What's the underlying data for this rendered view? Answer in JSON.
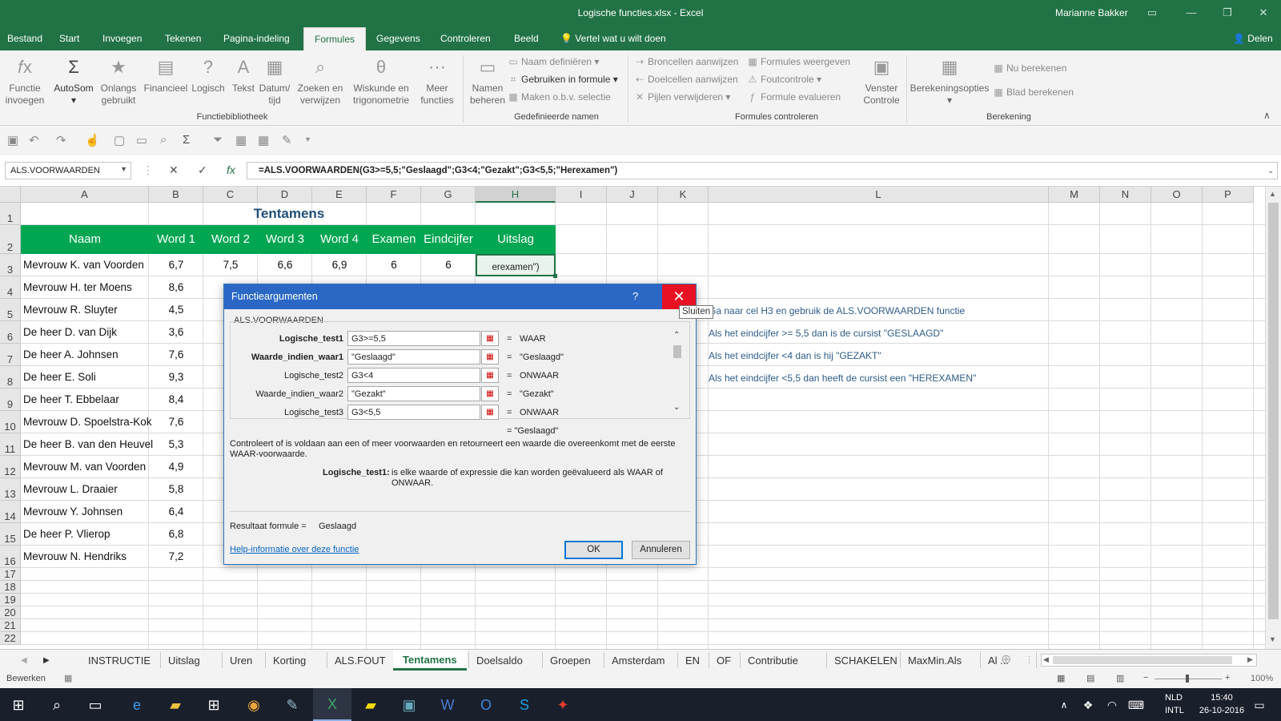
{
  "window": {
    "title": "Logische functies.xlsx - Excel",
    "user": "Marianne Bakker"
  },
  "tabs": [
    "Bestand",
    "Start",
    "Invoegen",
    "Tekenen",
    "Pagina-indeling",
    "Formules",
    "Gegevens",
    "Controleren",
    "Beeld"
  ],
  "active_tab": "Formules",
  "tell_me": "Vertel wat u wilt doen",
  "share": "Delen",
  "ribbon": {
    "functiebibliotheek": {
      "label": "Functiebibliotheek",
      "buttons": [
        "Functie invoegen",
        "AutoSom",
        "Onlangs gebruikt",
        "Financieel",
        "Logisch",
        "Tekst",
        "Datum/ tijd",
        "Zoeken en verwijzen",
        "Wiskunde en trigonometrie",
        "Meer functies"
      ]
    },
    "gedefinieerde_namen": {
      "label": "Gedefinieerde namen",
      "big": "Namen beheren",
      "items": [
        "Naam definiëren",
        "Gebruiken in formule",
        "Maken o.b.v. selectie"
      ]
    },
    "formules_controleren": {
      "label": "Formules controleren",
      "items": [
        "Broncellen aanwijzen",
        "Doelcellen aanwijzen",
        "Pijlen verwijderen",
        "Formules weergeven",
        "Foutcontrole",
        "Formule evalueren"
      ],
      "big": "Venster Controle"
    },
    "berekening": {
      "label": "Berekening",
      "big": "Berekeningsopties",
      "items": [
        "Nu berekenen",
        "Blad berekenen"
      ]
    }
  },
  "formula_bar": {
    "name_box": "ALS.VOORWAARDEN",
    "formula": "=ALS.VOORWAARDEN(G3>=5,5;\"Geslaagd\";G3<4;\"Gezakt\";G3<5,5;\"Herexamen\")"
  },
  "columns": [
    "A",
    "B",
    "C",
    "D",
    "E",
    "F",
    "G",
    "H",
    "I",
    "J",
    "K",
    "L",
    "M",
    "N",
    "O",
    "P"
  ],
  "rows": [
    "1",
    "2",
    "3",
    "4",
    "5",
    "6",
    "7",
    "8",
    "9",
    "10",
    "11",
    "12",
    "13",
    "14",
    "15",
    "16",
    "17",
    "18",
    "19",
    "20",
    "21",
    "22"
  ],
  "sheet": {
    "title": "Tentamens",
    "headers": [
      "Naam",
      "Word 1",
      "Word 2",
      "Word 3",
      "Word 4",
      "Examen",
      "Eindcijfer",
      "Uitslag"
    ],
    "row3": [
      "Mevrouw K. van Voorden",
      "6,7",
      "7,5",
      "6,6",
      "6,9",
      "6",
      "6"
    ],
    "selected_cell_text": "erexamen\")",
    "names": [
      {
        "name": "Mevrouw H. ter Moens",
        "b": "8,6"
      },
      {
        "name": "Mevrouw R. Sluyter",
        "b": "4,5"
      },
      {
        "name": "De heer D. van Dijk",
        "b": "3,6"
      },
      {
        "name": "De heer A. Johnsen",
        "b": "7,6"
      },
      {
        "name": "De heer E. Soli",
        "b": "9,3"
      },
      {
        "name": "De heer T. Ebbelaar",
        "b": "8,4"
      },
      {
        "name": "Mevrouw D. Spoelstra-Kok",
        "b": "7,6"
      },
      {
        "name": "De heer B. van den Heuvel",
        "b": "5,3"
      },
      {
        "name": "Mevrouw M. van Voorden",
        "b": "4,9"
      },
      {
        "name": "Mevrouw L. Draaier",
        "b": "5,8"
      },
      {
        "name": "Mevrouw Y. Johnsen",
        "b": "6,4"
      },
      {
        "name": "De heer P. Vlierop",
        "b": "6,8"
      },
      {
        "name": "Mevrouw N. Hendriks",
        "b": "7,2"
      }
    ],
    "notes": [
      "Ga naar cel H3 en gebruik de ALS.VOORWAARDEN functie",
      "Als het eindcijfer >= 5,5 dan is de cursist \"GESLAAGD\"",
      "Als het eindcijfer <4 dan is hij \"GEZAKT\"",
      "Als het eindcijfer <5,5 dan heeft de cursist een \"HEREXAMEN\""
    ]
  },
  "dialog": {
    "title": "Functieargumenten",
    "help": "?",
    "close_tooltip": "Sluiten",
    "function_name": "ALS.VOORWAARDEN",
    "args": [
      {
        "label": "Logische_test1",
        "value": "G3>=5,5",
        "result": "WAAR"
      },
      {
        "label": "Waarde_indien_waar1",
        "value": "\"Geslaagd\"",
        "result": "\"Geslaagd\""
      },
      {
        "label": "Logische_test2",
        "value": "G3<4",
        "result": "ONWAAR"
      },
      {
        "label": "Waarde_indien_waar2",
        "value": "\"Gezakt\"",
        "result": "\"Gezakt\""
      },
      {
        "label": "Logische_test3",
        "value": "G3<5,5",
        "result": "ONWAAR"
      }
    ],
    "overall": "=  \"Geslaagd\"",
    "description": "Controleert of is voldaan aan een of meer voorwaarden en retourneert een waarde die overeenkomt met de eerste WAAR-voorwaarde.",
    "arg_help_label": "Logische_test1:",
    "arg_help_text": "is elke waarde of expressie die kan worden geëvalueerd als WAAR of ONWAAR.",
    "result_label": "Resultaat formule =",
    "result_value": "Geslaagd",
    "help_link": "Help-informatie over deze functie",
    "ok": "OK",
    "cancel": "Annuleren"
  },
  "sheet_tabs": [
    "INSTRUCTIE",
    "Uitslag",
    "Uren",
    "Korting",
    "ALS.FOUT",
    "Tentamens",
    "Doelsaldo",
    "Groepen",
    "Amsterdam",
    "EN",
    "OF",
    "Contributie",
    "SCHAKELEN",
    "MaxMin.Als",
    "Al ..."
  ],
  "active_sheet": "Tentamens",
  "status": {
    "mode": "Bewerken",
    "zoom": "100%"
  },
  "taskbar": {
    "lang": "NLD",
    "layout": "INTL",
    "time": "15:40",
    "date": "26-10-2016"
  },
  "colors": {
    "excel_green": "#217346",
    "header_fill": "#00a651",
    "dialog_blue": "#2b68c6"
  }
}
